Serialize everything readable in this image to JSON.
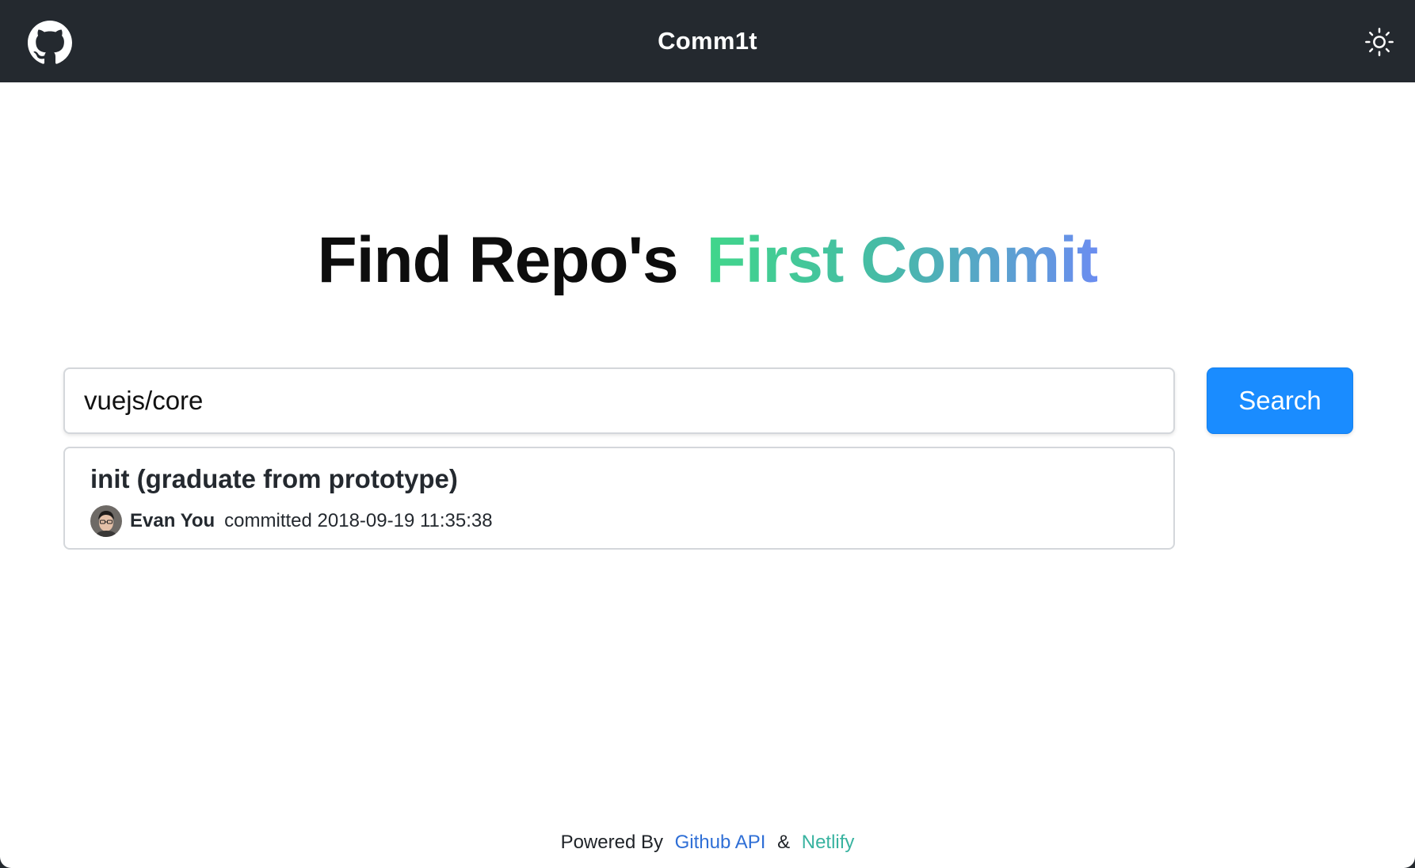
{
  "navbar": {
    "brand": "Comm1t",
    "logo_icon": "github-icon",
    "theme_icon": "sun-icon"
  },
  "hero": {
    "title_plain": "Find Repo's",
    "title_highlight": "First Commit",
    "gradient_colors": [
      "#41d68b",
      "#46bba6",
      "#6b8df0"
    ]
  },
  "search": {
    "value": "vuejs/core",
    "button_label": "Search",
    "button_color": "#1a8cff"
  },
  "result": {
    "message": "init (graduate from prototype)",
    "author": "Evan You",
    "committed": "committed 2018-09-19 11:35:38",
    "avatar_icon": "author-avatar"
  },
  "footer": {
    "prefix": "Powered By",
    "link_github": "Github API",
    "ampersand": "&",
    "link_netlify": "Netlify"
  },
  "colors": {
    "navbar_bg": "#24292f",
    "link_github": "#2f6fd6",
    "link_netlify": "#39b3a0"
  }
}
